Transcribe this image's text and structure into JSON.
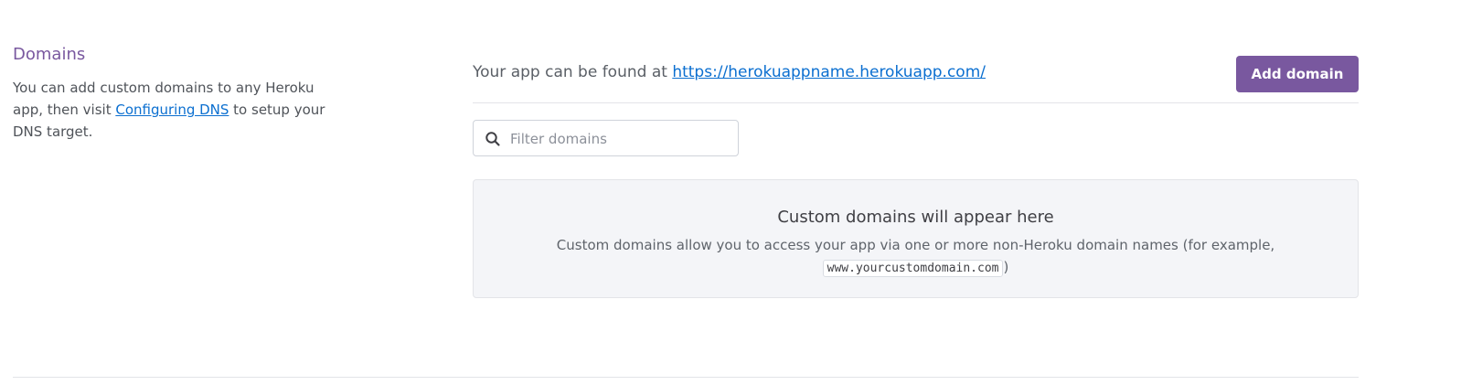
{
  "domains_section": {
    "title": "Domains",
    "description_before": "You can add custom domains to any Heroku app, then visit ",
    "link_label": "Configuring DNS",
    "description_after": " to setup your DNS target."
  },
  "header": {
    "found_at_label": "Your app can be found at ",
    "app_url": "https://herokuappname.herokuapp.com/",
    "add_domain_label": "Add domain"
  },
  "filter": {
    "placeholder": "Filter domains",
    "value": ""
  },
  "empty_state": {
    "title": "Custom domains will appear here",
    "description": "Custom domains allow you to access your app via one or more non-Heroku domain names (for example, ",
    "example_domain": "www.yourcustomdomain.com",
    "description_end": ")"
  },
  "colors": {
    "accent": "#79589f",
    "link": "#0b6fd0",
    "empty_bg": "#f4f5f8"
  },
  "icons": {
    "filter_icon": "search-icon"
  }
}
